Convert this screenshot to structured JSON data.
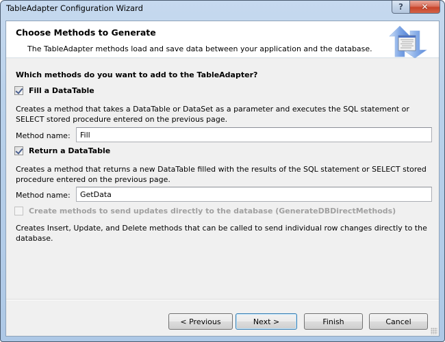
{
  "window": {
    "title": "TableAdapter Configuration Wizard",
    "help_glyph": "?",
    "close_glyph": "✕"
  },
  "header": {
    "title": "Choose Methods to Generate",
    "subtitle": "The TableAdapter methods load and save data between your application and the database.",
    "icon": "transfer-arrows-icon"
  },
  "body": {
    "question": "Which methods do you want to add to the TableAdapter?",
    "fill": {
      "label": "Fill a DataTable",
      "checked": true,
      "description": "Creates a method that takes a DataTable or DataSet as a parameter and executes the SQL statement or SELECT stored procedure entered on the previous page.",
      "method_label": "Method name:",
      "method_value": "Fill"
    },
    "return": {
      "label": "Return a DataTable",
      "checked": true,
      "description": "Creates a method that returns a new DataTable filled with the results of the SQL statement or SELECT stored procedure entered on the previous page.",
      "method_label": "Method name:",
      "method_value": "GetData"
    },
    "direct": {
      "label": "Create methods to send updates directly to the database (GenerateDBDirectMethods)",
      "checked": false,
      "enabled": false,
      "description": "Creates Insert, Update, and Delete methods that can be called to send individual row changes directly to the database."
    }
  },
  "footer": {
    "previous": "< Previous",
    "next": "Next >",
    "finish": "Finish",
    "cancel": "Cancel"
  }
}
